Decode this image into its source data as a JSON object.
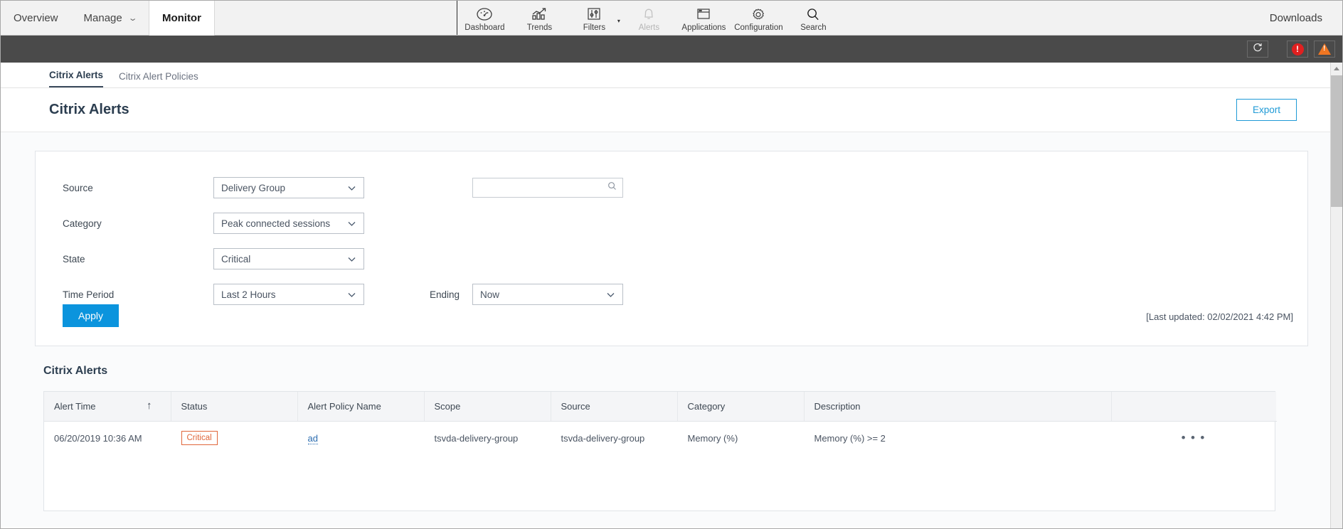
{
  "topnav": {
    "items": [
      {
        "label": "Overview",
        "active": false,
        "caret": false
      },
      {
        "label": "Manage",
        "active": false,
        "caret": true
      },
      {
        "label": "Monitor",
        "active": true,
        "caret": false
      }
    ],
    "icons": [
      {
        "label": "Dashboard",
        "icon": "gauge-icon",
        "disabled": false,
        "caret": false
      },
      {
        "label": "Trends",
        "icon": "trends-chart-icon",
        "disabled": false,
        "caret": false
      },
      {
        "label": "Filters",
        "icon": "sliders-icon",
        "disabled": false,
        "caret": true
      },
      {
        "label": "Alerts",
        "icon": "bell-icon",
        "disabled": true,
        "caret": false
      },
      {
        "label": "Applications",
        "icon": "window-icon",
        "disabled": false,
        "caret": false
      },
      {
        "label": "Configuration",
        "icon": "gear-icon",
        "disabled": false,
        "caret": false
      },
      {
        "label": "Search",
        "icon": "search-icon",
        "disabled": false,
        "caret": false
      }
    ],
    "downloads_label": "Downloads"
  },
  "darkbar": {
    "refresh_icon": "refresh-icon",
    "error_badge": "!",
    "error_icon": "error-circle-icon",
    "warning_icon": "warning-triangle-icon"
  },
  "subtabs": [
    {
      "label": "Citrix Alerts",
      "active": true
    },
    {
      "label": "Citrix Alert Policies",
      "active": false
    }
  ],
  "page": {
    "title": "Citrix Alerts",
    "export_label": "Export"
  },
  "filters": {
    "rows": [
      {
        "label": "Source",
        "value": "Delivery Group"
      },
      {
        "label": "Category",
        "value": "Peak connected sessions"
      },
      {
        "label": "State",
        "value": "Critical"
      },
      {
        "label": "Time Period",
        "value": "Last 2 Hours"
      }
    ],
    "search": {
      "value": "",
      "placeholder": "",
      "icon": "search-icon"
    },
    "ending": {
      "label": "Ending",
      "value": "Now"
    },
    "apply_label": "Apply",
    "last_updated": "[Last updated: 02/02/2021 4:42 PM]"
  },
  "table": {
    "title": "Citrix Alerts",
    "columns": [
      {
        "label": "Alert Time",
        "sorted": true,
        "sort_glyph": "↑"
      },
      {
        "label": "Status",
        "sorted": false
      },
      {
        "label": "Alert Policy Name",
        "sorted": false
      },
      {
        "label": "Scope",
        "sorted": false
      },
      {
        "label": "Source",
        "sorted": false
      },
      {
        "label": "Category",
        "sorted": false
      },
      {
        "label": "Description",
        "sorted": false
      },
      {
        "label": "",
        "sorted": false
      }
    ],
    "rows": [
      {
        "alert_time": "06/20/2019 10:36 AM",
        "status": "Critical",
        "alert_policy_name": "ad",
        "scope": "tsvda-delivery-group",
        "source": "tsvda-delivery-group",
        "category": "Memory (%)",
        "description": "Memory (%) >= 2",
        "menu": "• • •"
      }
    ]
  },
  "colors": {
    "accent_blue": "#0b94dd",
    "link_blue": "#1f9ad6",
    "critical_orange": "#e0663a",
    "dark_toolbar": "#4a4a4a",
    "error_red": "#e02020",
    "warning_orange": "#ef7622"
  }
}
